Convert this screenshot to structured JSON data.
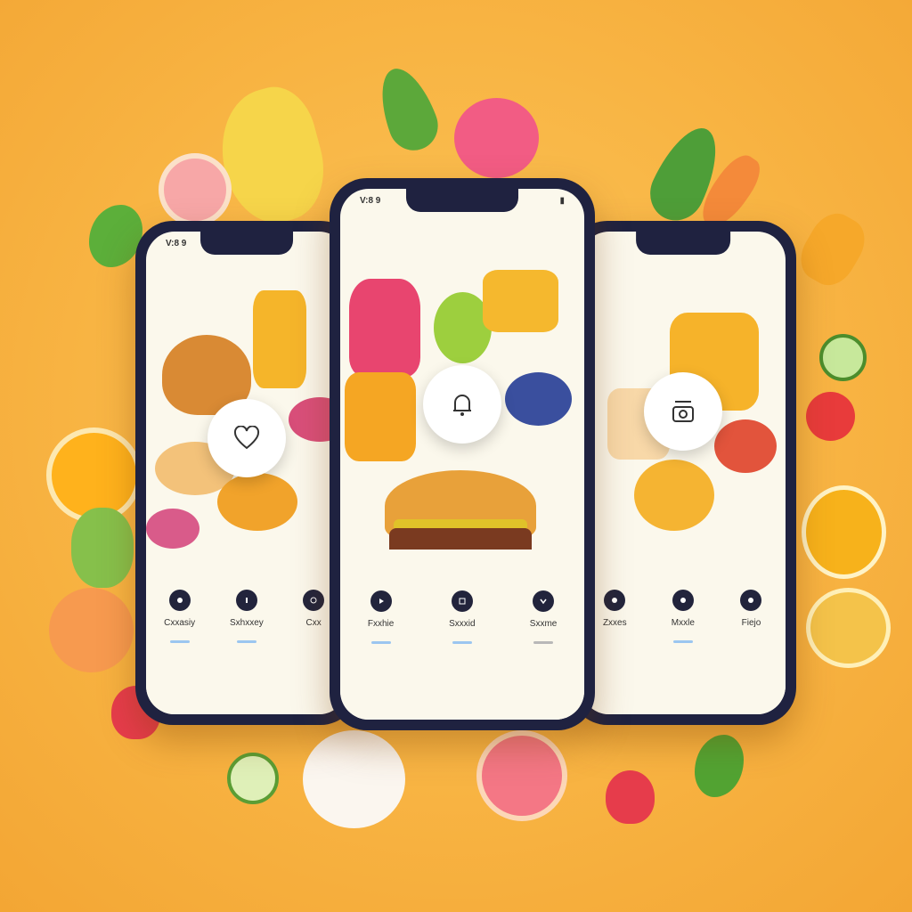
{
  "colors": {
    "background": "#f8b443",
    "phone_frame": "#1f2240",
    "screen": "#fbf8ec",
    "accent_blue": "#9bc6f0"
  },
  "phones": [
    {
      "status_left": "V:8 9",
      "center_icon": "heart-icon",
      "nav": [
        {
          "label": "Cxxasiy",
          "icon": "leaf-icon"
        },
        {
          "label": "Sxhxxey",
          "icon": "drop-icon"
        },
        {
          "label": "Cxx",
          "icon": "circle-icon"
        }
      ]
    },
    {
      "status_left": "V:8 9",
      "center_icon": "bell-icon",
      "nav": [
        {
          "label": "Fxxhie",
          "icon": "play-icon"
        },
        {
          "label": "Sxxxid",
          "icon": "square-icon"
        },
        {
          "label": "Sxxme",
          "icon": "chevron-down-icon"
        }
      ]
    },
    {
      "status_left": "",
      "center_icon": "scale-icon",
      "nav": [
        {
          "label": "Zxxes",
          "icon": "circle-icon"
        },
        {
          "label": "Mxxle",
          "icon": "circle-icon"
        },
        {
          "label": "Fiejo",
          "icon": "circle-icon"
        }
      ]
    }
  ]
}
